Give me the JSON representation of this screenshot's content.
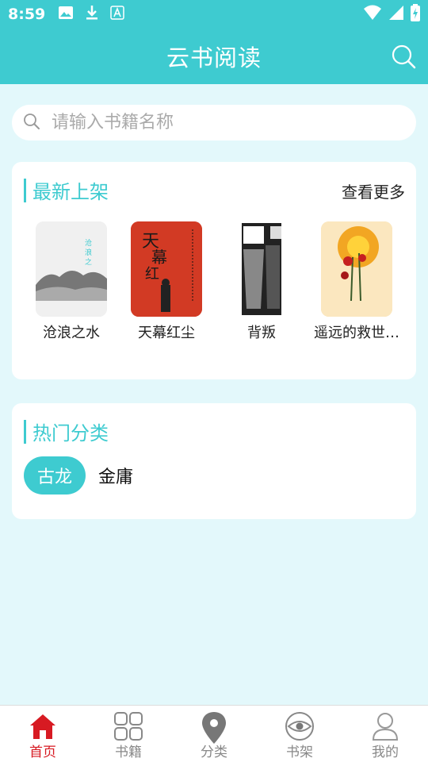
{
  "status": {
    "time": "8:59"
  },
  "app": {
    "title": "云书阅读"
  },
  "search": {
    "placeholder": "请输入书籍名称"
  },
  "latest": {
    "title": "最新上架",
    "more": "查看更多",
    "books": [
      {
        "title": "沧浪之水",
        "cover_color": "#eeeeee"
      },
      {
        "title": "天幕红尘",
        "cover_color": "#d23a24"
      },
      {
        "title": "背叛",
        "cover_color": "#ffffff"
      },
      {
        "title": "遥远的救世…",
        "cover_color": "#f7d7a0"
      }
    ]
  },
  "hot": {
    "title": "热门分类",
    "tags": [
      "古龙",
      "金庸"
    ]
  },
  "nav": {
    "items": [
      {
        "label": "首页",
        "icon": "home-icon",
        "active": true
      },
      {
        "label": "书籍",
        "icon": "grid-icon"
      },
      {
        "label": "分类",
        "icon": "location-pin-icon"
      },
      {
        "label": "书架",
        "icon": "eye-icon"
      },
      {
        "label": "我的",
        "icon": "user-icon"
      }
    ]
  },
  "colors": {
    "accent": "#3ecbd0",
    "active_nav": "#d71a22"
  }
}
